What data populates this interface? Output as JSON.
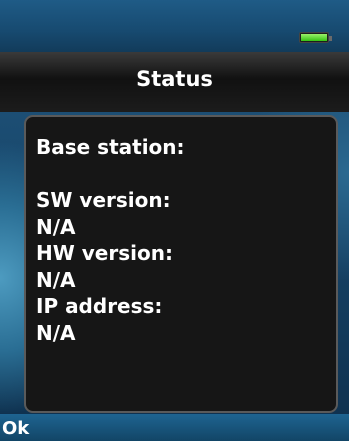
{
  "statusbar": {
    "battery_icon": "battery-full-icon",
    "battery_color": "#36c214"
  },
  "header": {
    "title": "Status"
  },
  "status": {
    "base_station_label": "Base station:",
    "base_station_value": "",
    "sw_version_label": "SW version:",
    "sw_version_value": "N/A",
    "hw_version_label": "HW version:",
    "hw_version_value": "N/A",
    "ip_address_label": "IP address:",
    "ip_address_value": "N/A"
  },
  "softkey": {
    "left_label": "Ok"
  }
}
